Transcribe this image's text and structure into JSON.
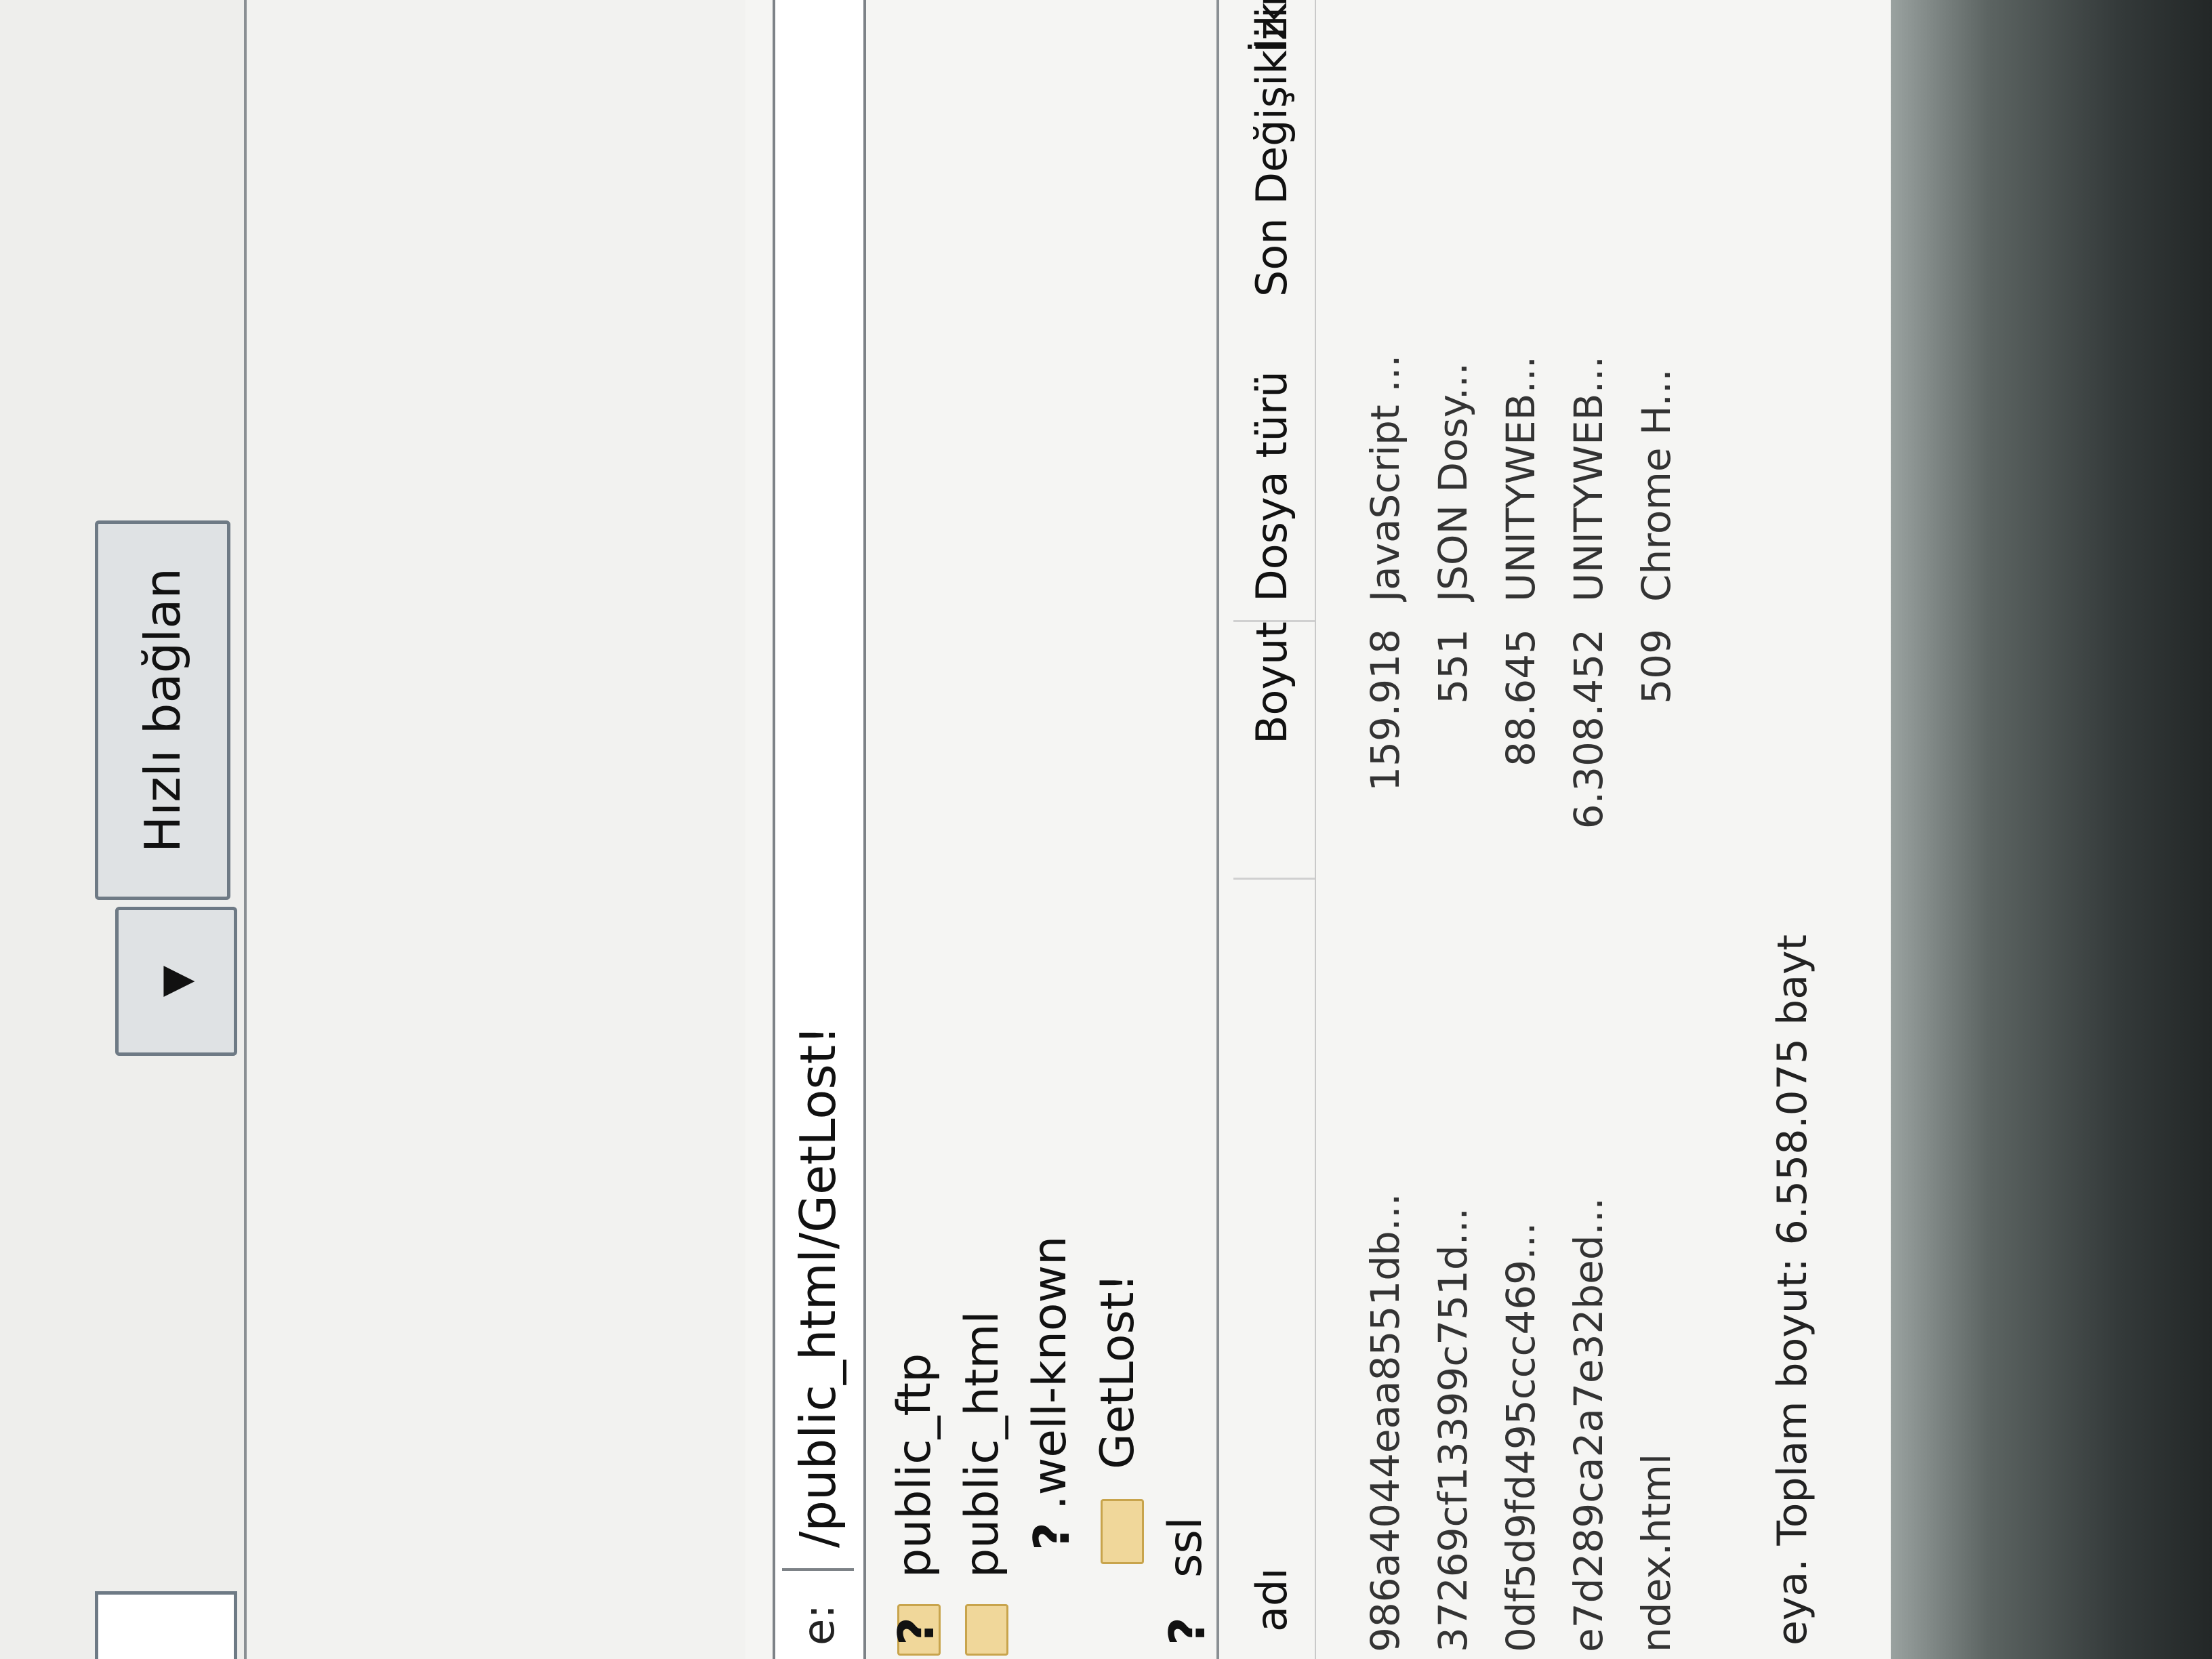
{
  "toolbar": {
    "quick_connect_label": "Hızlı bağlan",
    "dropdown_glyph": "▼"
  },
  "remote": {
    "path_label": "e:",
    "path_value": "/public_html/GetLost!",
    "tree": [
      {
        "label": "public_ftp",
        "icon": "folder-icon"
      },
      {
        "label": "public_html",
        "icon": "folder-icon"
      },
      {
        "label": ".well-known",
        "icon": "unknown-folder-icon"
      },
      {
        "label": "GetLost!",
        "icon": "folder-icon"
      },
      {
        "label": "ssl",
        "icon": "unknown-folder-icon"
      }
    ],
    "unknown_marker": "?",
    "columns": {
      "name": "adı",
      "size": "Boyut",
      "type": "Dosya türü",
      "modified": "Son Değişiklik",
      "permissions": "İzinler"
    },
    "files": [
      {
        "name": "986a4044eaa8551db...",
        "size": "159.918",
        "type": "JavaScript ..."
      },
      {
        "name": "37269cf13399c751d...",
        "size": "551",
        "type": "JSON Dosy..."
      },
      {
        "name": "0df5d9fd495ccc469...",
        "size": "88.645",
        "type": "UNITYWEB..."
      },
      {
        "name": "e7d289ca2a7e32bed...",
        "size": "6.308.452",
        "type": "UNITYWEB..."
      },
      {
        "name": "ndex.html",
        "size": "509",
        "type": "Chrome H..."
      }
    ],
    "status": "eya. Toplam boyut: 6.558.075 bayt"
  }
}
